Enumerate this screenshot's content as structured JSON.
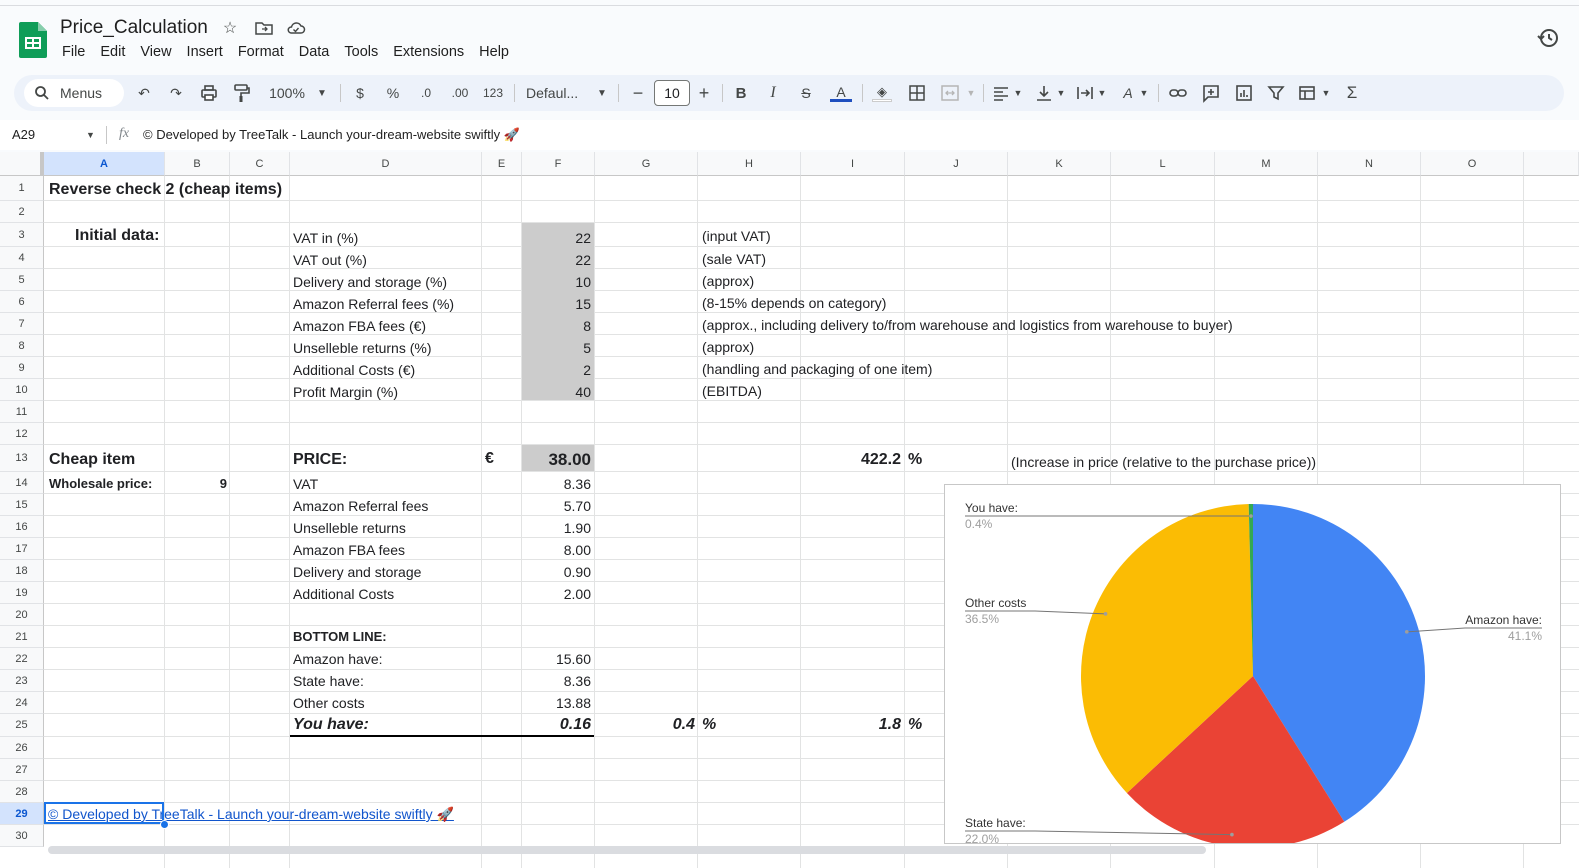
{
  "app": {
    "doc_title": "Price_Calculation"
  },
  "menu": [
    "File",
    "Edit",
    "View",
    "Insert",
    "Format",
    "Data",
    "Tools",
    "Extensions",
    "Help"
  ],
  "toolbar": {
    "menus_label": "Menus",
    "zoom": "100%",
    "currency": "$",
    "percent": "%",
    "dec_decrease": ".0",
    "dec_increase": ".00",
    "number_format": "123",
    "font_family": "Defaul...",
    "font_size": "10"
  },
  "formula_bar": {
    "cell_ref": "A29",
    "content": "© Developed by TreeTalk - Launch your-dream-website swiftly 🚀"
  },
  "columns": [
    "A",
    "B",
    "C",
    "D",
    "E",
    "F",
    "G",
    "H",
    "I",
    "J",
    "K",
    "L",
    "M",
    "N",
    "O"
  ],
  "rows": [
    "1",
    "2",
    "3",
    "4",
    "5",
    "6",
    "7",
    "8",
    "9",
    "10",
    "11",
    "12",
    "13",
    "14",
    "15",
    "16",
    "17",
    "18",
    "19",
    "20",
    "21",
    "22",
    "23",
    "24",
    "25",
    "26",
    "27",
    "28",
    "29",
    "30"
  ],
  "cells": {
    "a1": "Reverse check 2 (cheap items)",
    "a3": "Initial data:",
    "inputs": [
      {
        "label": "VAT in (%)",
        "value": "22",
        "note": "(input VAT)"
      },
      {
        "label": "VAT out (%)",
        "value": "22",
        "note": "(sale VAT)"
      },
      {
        "label": "Delivery and storage (%)",
        "value": "10",
        "note": "(approx)"
      },
      {
        "label": "Amazon Referral fees (%)",
        "value": "15",
        "note": "(8-15% depends on category)"
      },
      {
        "label": "Amazon FBA fees (€)",
        "value": "8",
        "note": "(approx., including delivery to/from warehouse and logistics from warehouse to buyer)"
      },
      {
        "label": "Unselleble returns (%)",
        "value": "5",
        "note": "(approx)"
      },
      {
        "label": "Additional Costs (€)",
        "value": "2",
        "note": "(handling and packaging of one item)"
      },
      {
        "label": "Profit Margin (%)",
        "value": "40",
        "note": "(EBITDA)"
      }
    ],
    "a13": "Cheap item",
    "d13": "PRICE:",
    "e13": "€",
    "f13": "38.00",
    "i13": "422.2",
    "j13": "%",
    "k13": "(Increase in price (relative to the purchase price))",
    "a14": "Wholesale price:",
    "b14": "9",
    "costs": [
      {
        "label": "VAT",
        "value": "8.36"
      },
      {
        "label": "Amazon Referral fees",
        "value": "5.70"
      },
      {
        "label": "Unselleble returns",
        "value": "1.90"
      },
      {
        "label": "Amazon FBA fees",
        "value": "8.00"
      },
      {
        "label": "Delivery and storage",
        "value": "0.90"
      },
      {
        "label": "Additional Costs",
        "value": "2.00"
      }
    ],
    "d21": "BOTTOM LINE:",
    "bottom": [
      {
        "label": "Amazon have:",
        "value": "15.60"
      },
      {
        "label": "State have:",
        "value": "8.36"
      },
      {
        "label": "Other costs",
        "value": "13.88"
      }
    ],
    "d25": "You have:",
    "f25": "0.16",
    "g25": "0.4",
    "g25_pct": "%",
    "i25": "1.8",
    "j25": "%",
    "a29": "© Developed by TreeTalk - Launch your-dream-website swiftly 🚀"
  },
  "chart_data": {
    "type": "pie",
    "title": "",
    "categories": [
      "Amazon have:",
      "State have:",
      "Other costs",
      "You have:"
    ],
    "values": [
      41.1,
      22.0,
      36.5,
      0.4
    ],
    "value_labels": [
      "41.1%",
      "22.0%",
      "36.5%",
      "0.4%"
    ],
    "colors": [
      "#4285f4",
      "#ea4335",
      "#fbbc04",
      "#34a853"
    ],
    "legend": "labels"
  }
}
